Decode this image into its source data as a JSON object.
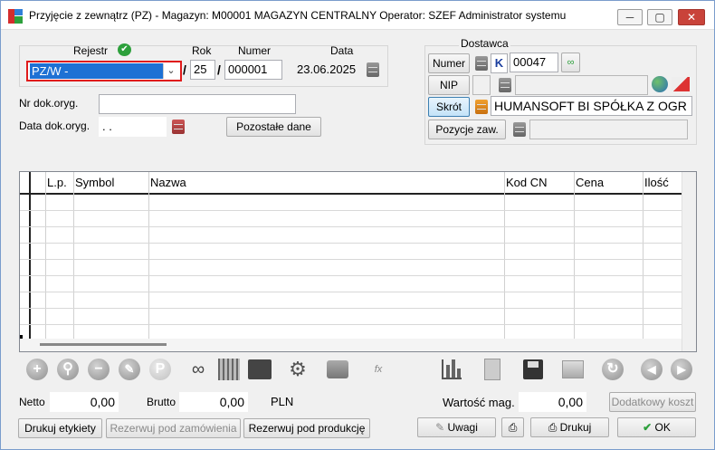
{
  "window": {
    "title": "Przyjęcie z zewnątrz (PZ) - Magazyn: M00001 MAGAZYN CENTRALNY  Operator: SZEF Administrator systemu",
    "minimize": "─",
    "maximize": "▢",
    "close": "✕"
  },
  "document": {
    "rejestr_label": "Rejestr",
    "rejestr_value": "PZ/W  -",
    "rok_label": "Rok",
    "rok_value": "25",
    "numer_label": "Numer",
    "numer_value": "000001",
    "data_label": "Data",
    "data_value": "23.06.2025",
    "slash": "/",
    "nr_dok_label": "Nr dok.oryg.",
    "nr_dok_value": "",
    "data_dok_label": "Data dok.oryg.",
    "data_dok_value": "  .  .",
    "pozostale_button": "Pozostałe dane"
  },
  "dostawca": {
    "title": "Dostawca",
    "numer_button": "Numer",
    "k_label": "K",
    "numer_value": "00047",
    "nip_button": "NIP",
    "nip_value": "",
    "skrot_button": "Skrót",
    "skrot_value": "HUMANSOFT BI SPÓŁKA Z OGR",
    "pozycje_button": "Pozycje zaw.",
    "pozycje_value": ""
  },
  "grid": {
    "columns": [
      "",
      "L.p.",
      "Symbol",
      "Nazwa",
      "Kod CN",
      "Cena",
      "Ilość"
    ],
    "rows": []
  },
  "toolbar": {
    "icons": [
      "add-icon",
      "search-item-icon",
      "remove-icon",
      "edit-item-icon",
      "p-icon",
      "binoculars-icon",
      "table-icon",
      "calculator-icon",
      "settings-icon",
      "window-icon",
      "fx-icon",
      "chart-icon",
      "document-icon",
      "save-icon",
      "copy-icon",
      "refresh-icon",
      "prev-icon",
      "next-icon"
    ],
    "fx_label": "fx"
  },
  "totals": {
    "netto_label": "Netto",
    "netto_value": "0,00",
    "brutto_label": "Brutto",
    "brutto_value": "0,00",
    "currency": "PLN",
    "wartosc_label": "Wartość mag.",
    "wartosc_value": "0,00",
    "dodatkowy_button": "Dodatkowy koszt"
  },
  "actions": {
    "drukuj_etykiety": "Drukuj etykiety",
    "rezerwuj_zamowienia": "Rezerwuj pod zamówienia",
    "rezerwuj_produkcje": "Rezerwuj pod produkcję",
    "uwagi": "Uwagi",
    "drukuj": "Drukuj",
    "ok": "OK"
  },
  "colors": {
    "selection": "#1e71d4",
    "highlight_border": "#e01b1b",
    "ok_check": "#2da03c"
  }
}
